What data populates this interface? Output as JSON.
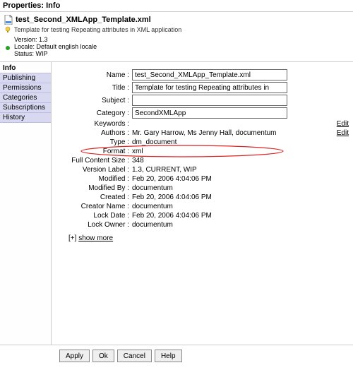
{
  "dialog": {
    "title": "Properties: Info"
  },
  "header": {
    "filename": "test_Second_XMLApp_Template.xml",
    "description": "Template for testing Repeating attributes in XML application",
    "version_label": "Version:",
    "version": "1.3",
    "locale_label": "Locale:",
    "locale": "Default english locale",
    "status_label": "Status:",
    "status": "WIP"
  },
  "sidebar": {
    "tabs": [
      {
        "label": "Info",
        "selected": true
      },
      {
        "label": "Publishing",
        "selected": false
      },
      {
        "label": "Permissions",
        "selected": false
      },
      {
        "label": "Categories",
        "selected": false
      },
      {
        "label": "Subscriptions",
        "selected": false
      },
      {
        "label": "History",
        "selected": false
      }
    ]
  },
  "form": {
    "name_label": "Name :",
    "name_value": "test_Second_XMLApp_Template.xml",
    "title_label": "Title :",
    "title_value": "Template for testing Repeating attributes in",
    "subject_label": "Subject :",
    "subject_value": "",
    "category_label": "Category :",
    "category_value": "SecondXMLApp",
    "keywords_label": "Keywords :",
    "keywords_value": "",
    "authors_label": "Authors :",
    "authors_value": "Mr. Gary Harrow, Ms Jenny Hall, documentum",
    "type_label": "Type :",
    "type_value": "dm_document",
    "format_label": "Format :",
    "format_value": "xml",
    "fcs_label": "Full Content Size :",
    "fcs_value": "348",
    "vlabel_label": "Version Label :",
    "vlabel_value": "1.3, CURRENT, WIP",
    "modified_label": "Modified :",
    "modified_value": "Feb 20, 2006 4:04:06 PM",
    "modifiedby_label": "Modified By :",
    "modifiedby_value": "documentum",
    "created_label": "Created :",
    "created_value": "Feb 20, 2006 4:04:06 PM",
    "creator_label": "Creator Name :",
    "creator_value": "documentum",
    "lockdate_label": "Lock Date :",
    "lockdate_value": "Feb 20, 2006 4:04:06 PM",
    "lockowner_label": "Lock Owner :",
    "lockowner_value": "documentum",
    "edit_link": "Edit",
    "showmore_prefix": "[+] ",
    "showmore_label": "show more"
  },
  "footer": {
    "apply": "Apply",
    "ok": "Ok",
    "cancel": "Cancel",
    "help": "Help"
  }
}
